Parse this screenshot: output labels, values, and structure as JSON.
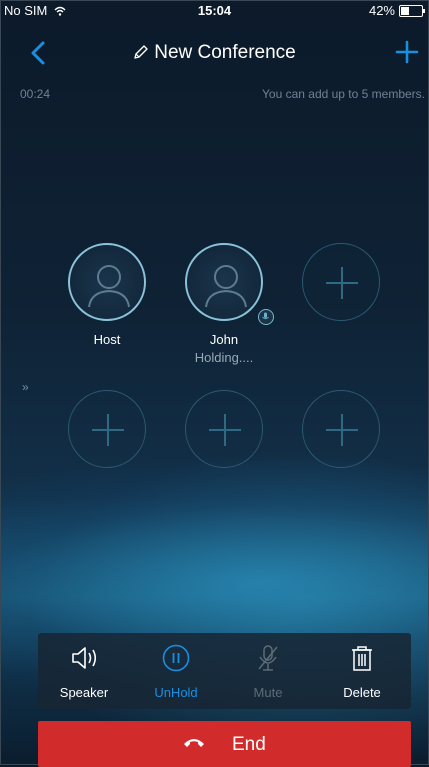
{
  "status": {
    "carrier": "No SIM",
    "time": "15:04",
    "battery": "42%",
    "battery_level": 0.42
  },
  "nav": {
    "title": "New Conference",
    "back_icon": "chevron-left-icon",
    "add_icon": "plus-icon"
  },
  "call": {
    "timer": "00:24",
    "limit_note": "You can add up to 5 members."
  },
  "participants": [
    {
      "name": "Host",
      "status": ""
    },
    {
      "name": "John",
      "status": "Holding...."
    }
  ],
  "controls": {
    "speaker": "Speaker",
    "unhold": "UnHold",
    "mute": "Mute",
    "delete": "Delete"
  },
  "end_label": "End",
  "colors": {
    "accent": "#1a8fe0",
    "end_red": "#d22b2b",
    "disabled": "#5e6b76"
  }
}
